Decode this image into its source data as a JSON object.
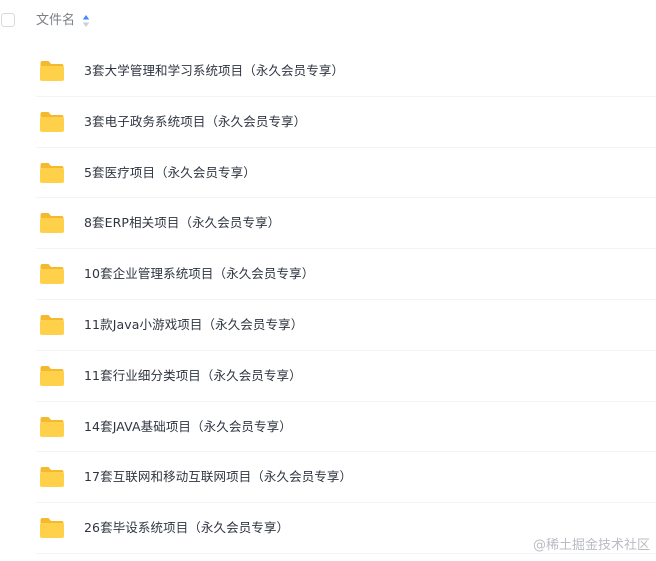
{
  "header": {
    "column_title": "文件名",
    "sort_icon": "sort-up-icon"
  },
  "files": [
    {
      "name": "3套大学管理和学习系统项目（永久会员专享）",
      "icon": "folder-icon"
    },
    {
      "name": "3套电子政务系统项目（永久会员专享）",
      "icon": "folder-icon"
    },
    {
      "name": "5套医疗项目（永久会员专享）",
      "icon": "folder-icon"
    },
    {
      "name": "8套ERP相关项目（永久会员专享）",
      "icon": "folder-icon"
    },
    {
      "name": "10套企业管理系统项目（永久会员专享）",
      "icon": "folder-icon"
    },
    {
      "name": "11款Java小游戏项目（永久会员专享）",
      "icon": "folder-icon"
    },
    {
      "name": "11套行业细分类项目（永久会员专享）",
      "icon": "folder-icon"
    },
    {
      "name": "14套JAVA基础项目（永久会员专享）",
      "icon": "folder-icon"
    },
    {
      "name": "17套互联网和移动互联网项目（永久会员专享）",
      "icon": "folder-icon"
    },
    {
      "name": "26套毕设系统项目（永久会员专享）",
      "icon": "folder-icon"
    }
  ],
  "watermark": "@稀土掘金技术社区",
  "colors": {
    "folder_body": "#ffd04a",
    "folder_tab": "#f5b92e",
    "sort_active": "#3d8bff",
    "sort_inactive": "#c9d0da",
    "text": "#2f3540",
    "muted": "#7c8087"
  }
}
